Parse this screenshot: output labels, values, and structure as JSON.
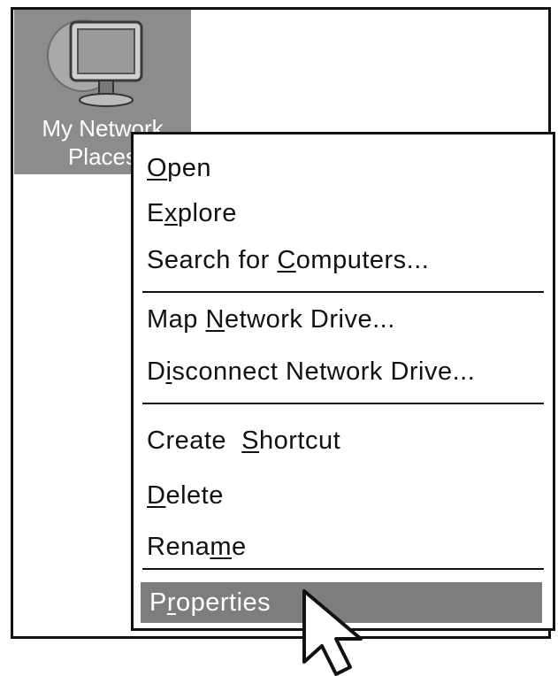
{
  "desktop": {
    "icon_label_line1": "My Network",
    "icon_label_line2": "Places",
    "icon": "network-computer-icon"
  },
  "context_menu": {
    "items": [
      {
        "pre": "",
        "key": "O",
        "post": "pen"
      },
      {
        "pre": "E",
        "key": "x",
        "post": "plore"
      },
      {
        "pre": "Search for ",
        "key": "C",
        "post": "omputers..."
      },
      {
        "pre": "Map ",
        "key": "N",
        "post": "etwork Drive..."
      },
      {
        "pre": "D",
        "key": "i",
        "post": "sconnect Network Drive..."
      },
      {
        "pre": "Create  ",
        "key": "S",
        "post": "hortcut"
      },
      {
        "pre": "",
        "key": "D",
        "post": "elete"
      },
      {
        "pre": "Rena",
        "key": "m",
        "post": "e"
      },
      {
        "pre": "P",
        "key": "r",
        "post": "operties"
      }
    ],
    "selected_item": "Properties"
  },
  "cursor": "arrow-cursor-icon",
  "colors": {
    "selection": "#7d7d7d",
    "icon_bg": "#8c8c8c",
    "border": "#111111"
  }
}
